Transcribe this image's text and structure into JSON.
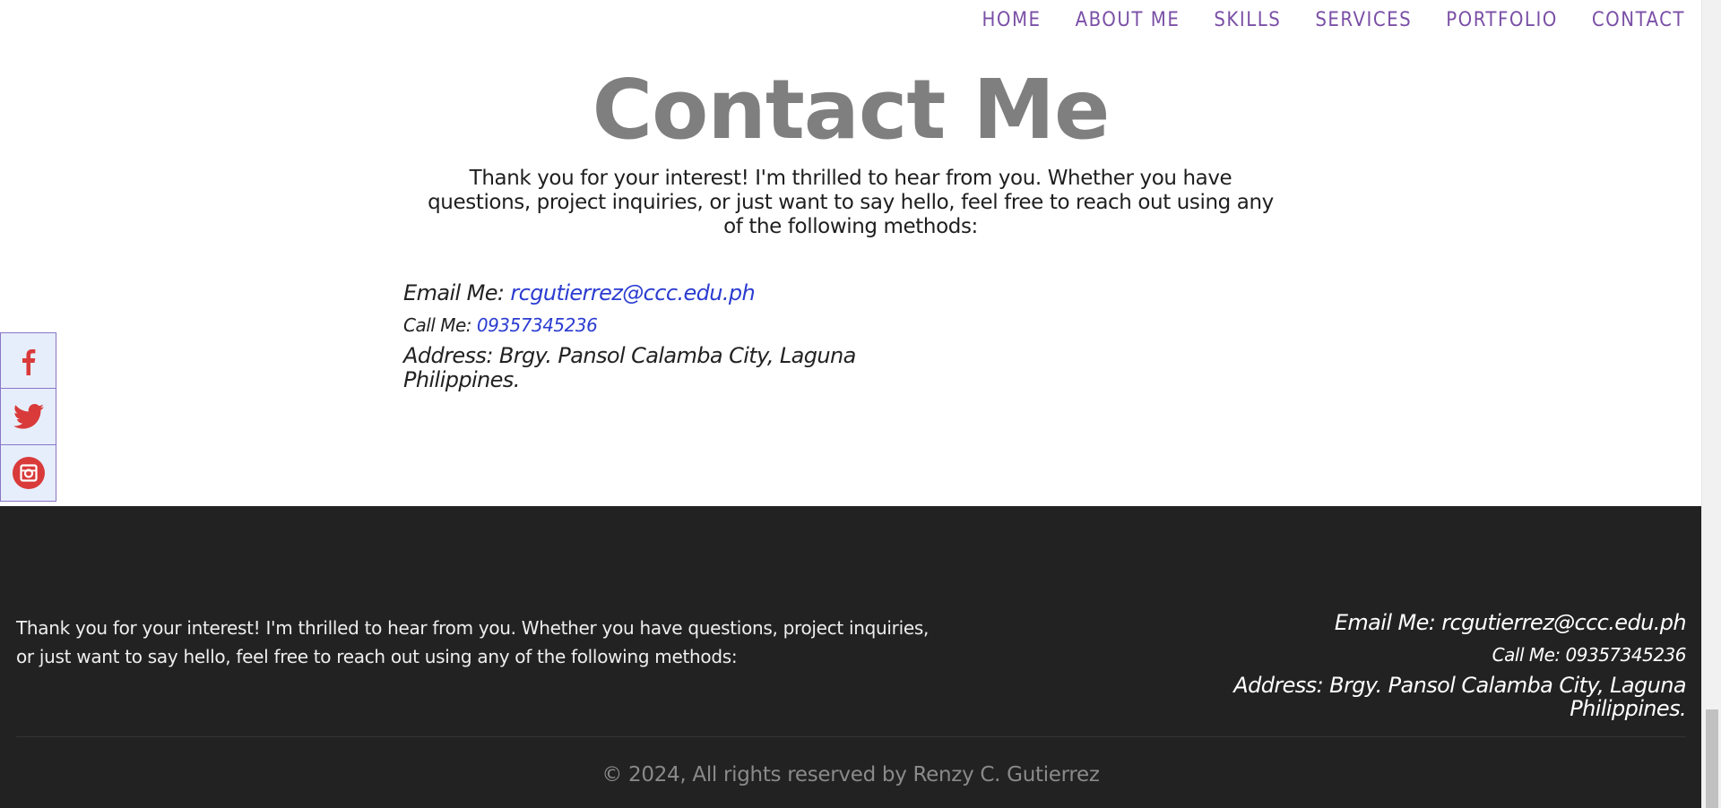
{
  "nav": {
    "items": [
      "HOME",
      "ABOUT ME",
      "SKILLS",
      "SERVICES",
      "PORTFOLIO",
      "CONTACT"
    ],
    "color": "#7a4fa6"
  },
  "contact": {
    "title": "Contact Me",
    "intro": "Thank you for your interest! I'm thrilled to hear from you. Whether you have questions, project inquiries, or just want to say hello, feel free to reach out using any of the following methods:",
    "email_label": "Email Me: ",
    "email_value": "rcgutierrez@ccc.edu.ph",
    "phone_label": "Call Me: ",
    "phone_value": "09357345236",
    "address_label": "Address: ",
    "address_value": "Brgy. Pansol Calamba City, Laguna Philippines.",
    "link_color": "#2b3cd1"
  },
  "social": {
    "icons": [
      "facebook-icon",
      "twitter-icon",
      "instagram-icon"
    ],
    "icon_color": "#d93a3a"
  },
  "footer": {
    "text": "Thank you for your interest! I'm thrilled to hear from you. Whether you have questions, project inquiries, or just want to say hello, feel free to reach out using any of the following methods:",
    "email": "Email Me: rcgutierrez@ccc.edu.ph",
    "phone": "Call Me: 09357345236",
    "address": "Address: Brgy. Pansol Calamba City, Laguna Philippines.",
    "copyright": "© 2024, All rights reserved by Renzy C. Gutierrez",
    "background": "#222222"
  }
}
